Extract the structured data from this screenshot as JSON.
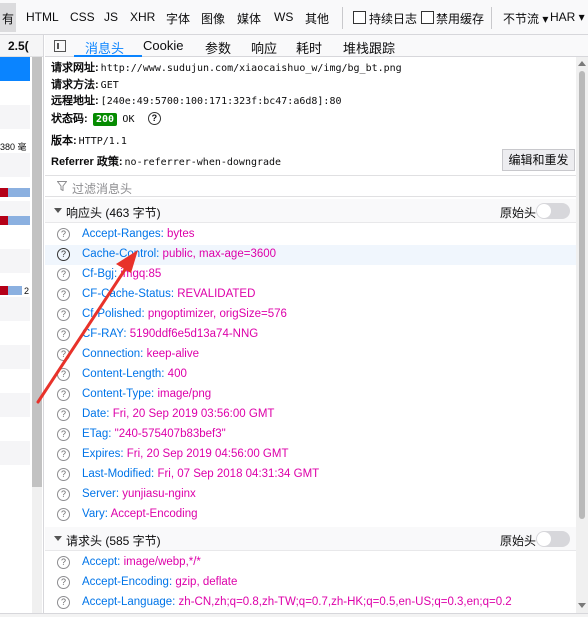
{
  "toolbar": {
    "types": [
      "有",
      "HTML",
      "CSS",
      "JS",
      "XHR",
      "字体",
      "图像",
      "媒体",
      "WS",
      "其他"
    ],
    "persist_logs": "持续日志",
    "disable_cache": "禁用缓存",
    "throttle": "不节流 ▾",
    "har": "HAR ▾"
  },
  "request_list": {
    "header": "2.5(",
    "text_1": "380 毫",
    "text_2": "2"
  },
  "tabs": [
    "消息头",
    "Cookie",
    "参数",
    "响应",
    "耗时",
    "堆栈跟踪"
  ],
  "summary": {
    "url_label": "请求网址:",
    "url": "http://www.sudujun.com/xiaocaishuo_w/img/bg_bt.png",
    "method_label": "请求方法:",
    "method": "GET",
    "remote_label": "远程地址:",
    "remote": "[240e:49:5700:100:171:323f:bc47:a6d8]:80",
    "status_label": "状态码:",
    "status_code": "200",
    "status_text": "OK",
    "version_label": "版本:",
    "version": "HTTP/1.1",
    "referrer_label": "Referrer 政策:",
    "referrer": "no-referrer-when-downgrade",
    "edit_resend": "编辑和重发"
  },
  "filter": {
    "placeholder": "过滤消息头"
  },
  "response_headers": {
    "title": "响应头 (463 字节)",
    "raw": "原始头",
    "rows": [
      {
        "name": "Accept-Ranges:",
        "value": "bytes"
      },
      {
        "name": "Cache-Control:",
        "value": "public, max-age=3600"
      },
      {
        "name": "Cf-Bgj:",
        "value": "imgq:85"
      },
      {
        "name": "CF-Cache-Status:",
        "value": "REVALIDATED"
      },
      {
        "name": "Cf-Polished:",
        "value": "pngoptimizer, origSize=576"
      },
      {
        "name": "CF-RAY:",
        "value": "5190ddf6e5d13a74-NNG"
      },
      {
        "name": "Connection:",
        "value": "keep-alive"
      },
      {
        "name": "Content-Length:",
        "value": "400"
      },
      {
        "name": "Content-Type:",
        "value": "image/png"
      },
      {
        "name": "Date:",
        "value": "Fri, 20 Sep 2019 03:56:00 GMT"
      },
      {
        "name": "ETag:",
        "value": "\"240-575407b83bef3\""
      },
      {
        "name": "Expires:",
        "value": "Fri, 20 Sep 2019 04:56:00 GMT"
      },
      {
        "name": "Last-Modified:",
        "value": "Fri, 07 Sep 2018 04:31:34 GMT"
      },
      {
        "name": "Server:",
        "value": "yunjiasu-nginx"
      },
      {
        "name": "Vary:",
        "value": "Accept-Encoding"
      }
    ]
  },
  "request_headers": {
    "title": "请求头 (585 字节)",
    "raw": "原始头",
    "rows": [
      {
        "name": "Accept:",
        "value": "image/webp,*/*"
      },
      {
        "name": "Accept-Encoding:",
        "value": "gzip, deflate"
      },
      {
        "name": "Accept-Language:",
        "value": "zh-CN,zh;q=0.8,zh-TW;q=0.7,zh-HK;q=0.5,en-US;q=0.3,en;q=0.2"
      }
    ]
  },
  "icons": {
    "help": "?"
  },
  "colors": {
    "accent": "#0a84ff",
    "header_name": "#0074e8",
    "header_value": "#dd00a9",
    "status_ok": "#058b00",
    "annotation": "#e8322a"
  }
}
